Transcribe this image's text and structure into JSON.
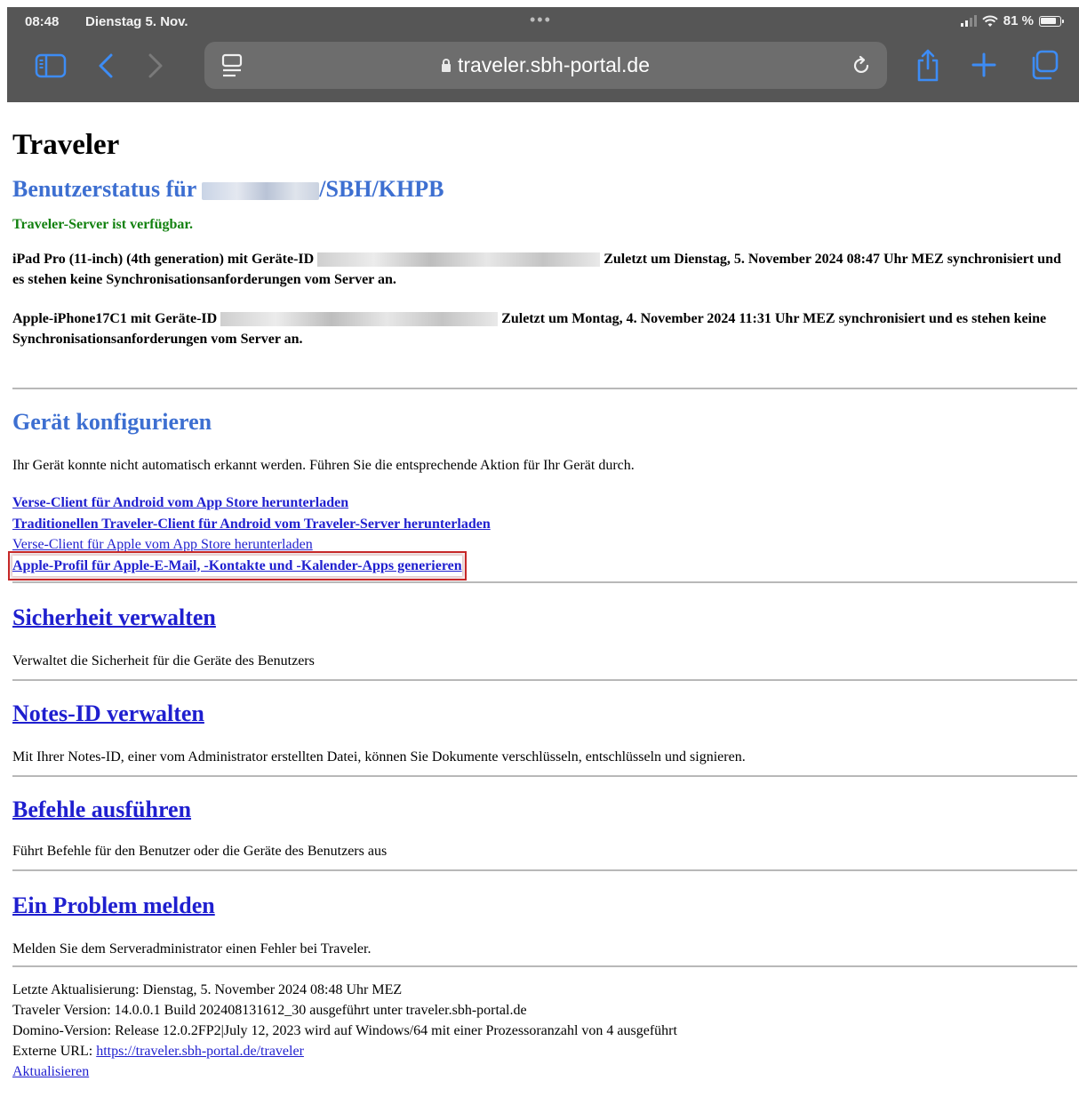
{
  "status_bar": {
    "time": "08:48",
    "date": "Dienstag 5. Nov.",
    "battery": "81 %"
  },
  "toolbar": {
    "url": "traveler.sbh-portal.de",
    "icons": [
      "sidebar-icon",
      "back-icon",
      "forward-icon",
      "reader-icon",
      "reload-icon",
      "share-icon",
      "plus-icon",
      "tabs-icon",
      "lock-icon"
    ]
  },
  "page": {
    "title": "Traveler",
    "user_status_prefix": "Benutzerstatus für ",
    "user_status_suffix": "/SBH/KHPB",
    "server_status": "Traveler-Server ist verfügbar.",
    "device1_prefix": "iPad Pro (11-inch) (4th generation) mit Geräte-ID ",
    "device1_suffix": " Zuletzt um Dienstag, 5. November 2024 08:47 Uhr MEZ synchronisiert und es stehen keine Synchronisationsanforderungen vom Server an.",
    "device2_prefix": "Apple-iPhone17C1 mit Geräte-ID ",
    "device2_suffix": " Zuletzt um Montag, 4. November 2024 11:31 Uhr MEZ synchronisiert und es stehen keine Synchronisationsanforderungen vom Server an."
  },
  "configure": {
    "heading": "Gerät konfigurieren",
    "description": "Ihr Gerät konnte nicht automatisch erkannt werden. Führen Sie die entsprechende Aktion für Ihr Gerät durch.",
    "links": [
      "Verse-Client für Android vom App Store herunterladen",
      "Traditionellen Traveler-Client für Android vom Traveler-Server herunterladen",
      "Verse-Client für Apple vom App Store herunterladen",
      "Apple-Profil für Apple-E-Mail, -Kontakte und -Kalender-Apps generieren"
    ]
  },
  "sections": {
    "security": {
      "heading": "Sicherheit verwalten",
      "description": "Verwaltet die Sicherheit für die Geräte des Benutzers"
    },
    "notes_id": {
      "heading": "Notes-ID verwalten",
      "description": "Mit Ihrer Notes-ID, einer vom Administrator erstellten Datei, können Sie Dokumente verschlüsseln, entschlüsseln und signieren."
    },
    "commands": {
      "heading": "Befehle ausführen",
      "description": "Führt Befehle für den Benutzer oder die Geräte des Benutzers aus"
    },
    "problem": {
      "heading": "Ein Problem melden",
      "description": "Melden Sie dem Serveradministrator einen Fehler bei Traveler."
    }
  },
  "footer": {
    "last_update": "Letzte Aktualisierung: Dienstag, 5. November 2024 08:48 Uhr MEZ",
    "traveler_version": "Traveler Version: 14.0.0.1 Build 202408131612_30 ausgeführt unter traveler.sbh-portal.de",
    "domino_version": "Domino-Version: Release 12.0.2FP2|July 12, 2023 wird auf Windows/64 mit einer Prozessoranzahl von 4 ausgeführt",
    "external_url_label": "Externe URL: ",
    "external_url": "https://traveler.sbh-portal.de/traveler",
    "refresh": "Aktualisieren"
  },
  "colors": {
    "link": "#1f1fcf",
    "heading_blue": "#3d6fd1",
    "server_ok": "#12810f",
    "highlight_box": "#c62828"
  }
}
